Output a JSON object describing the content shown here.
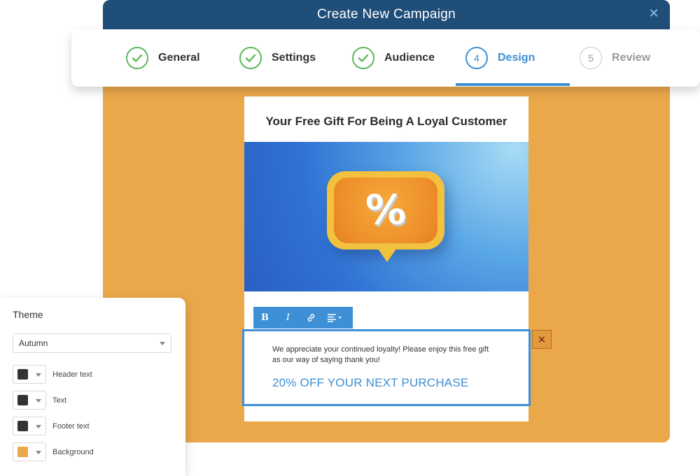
{
  "modal": {
    "title": "Create New Campaign",
    "close_icon": "close-icon",
    "background_color": "#eba84a"
  },
  "stepper": {
    "steps": [
      {
        "label": "General",
        "status": "complete",
        "icon": "check-circle-icon"
      },
      {
        "label": "Settings",
        "status": "complete",
        "icon": "check-circle-icon"
      },
      {
        "label": "Audience",
        "status": "complete",
        "icon": "check-circle-icon"
      },
      {
        "number": "4",
        "label": "Design",
        "status": "active"
      },
      {
        "number": "5",
        "label": "Review",
        "status": "upcoming"
      }
    ],
    "active_color": "#3d8fd6",
    "complete_color": "#5cb85c"
  },
  "email": {
    "headline": "Your Free Gift For Being A Loyal Customer",
    "hero_icon": "percent-speech-bubble",
    "hero_symbol": "%",
    "body": "We appreciate your continued loyalty! Please enjoy this free gift as our way of saying thank you!",
    "offer": "20% OFF YOUR NEXT PURCHASE"
  },
  "toolbar": {
    "buttons": [
      {
        "icon": "bold-icon",
        "glyph": "B"
      },
      {
        "icon": "italic-icon",
        "glyph": "I"
      },
      {
        "icon": "link-icon"
      },
      {
        "icon": "align-dropdown-icon"
      }
    ]
  },
  "theme_panel": {
    "heading": "Theme",
    "selected_theme": "Autumn",
    "colors": [
      {
        "label": "Header text",
        "color": "#333333"
      },
      {
        "label": "Text",
        "color": "#333333"
      },
      {
        "label": "Footer text",
        "color": "#333333"
      },
      {
        "label": "Background",
        "color": "#eba84a"
      }
    ]
  }
}
